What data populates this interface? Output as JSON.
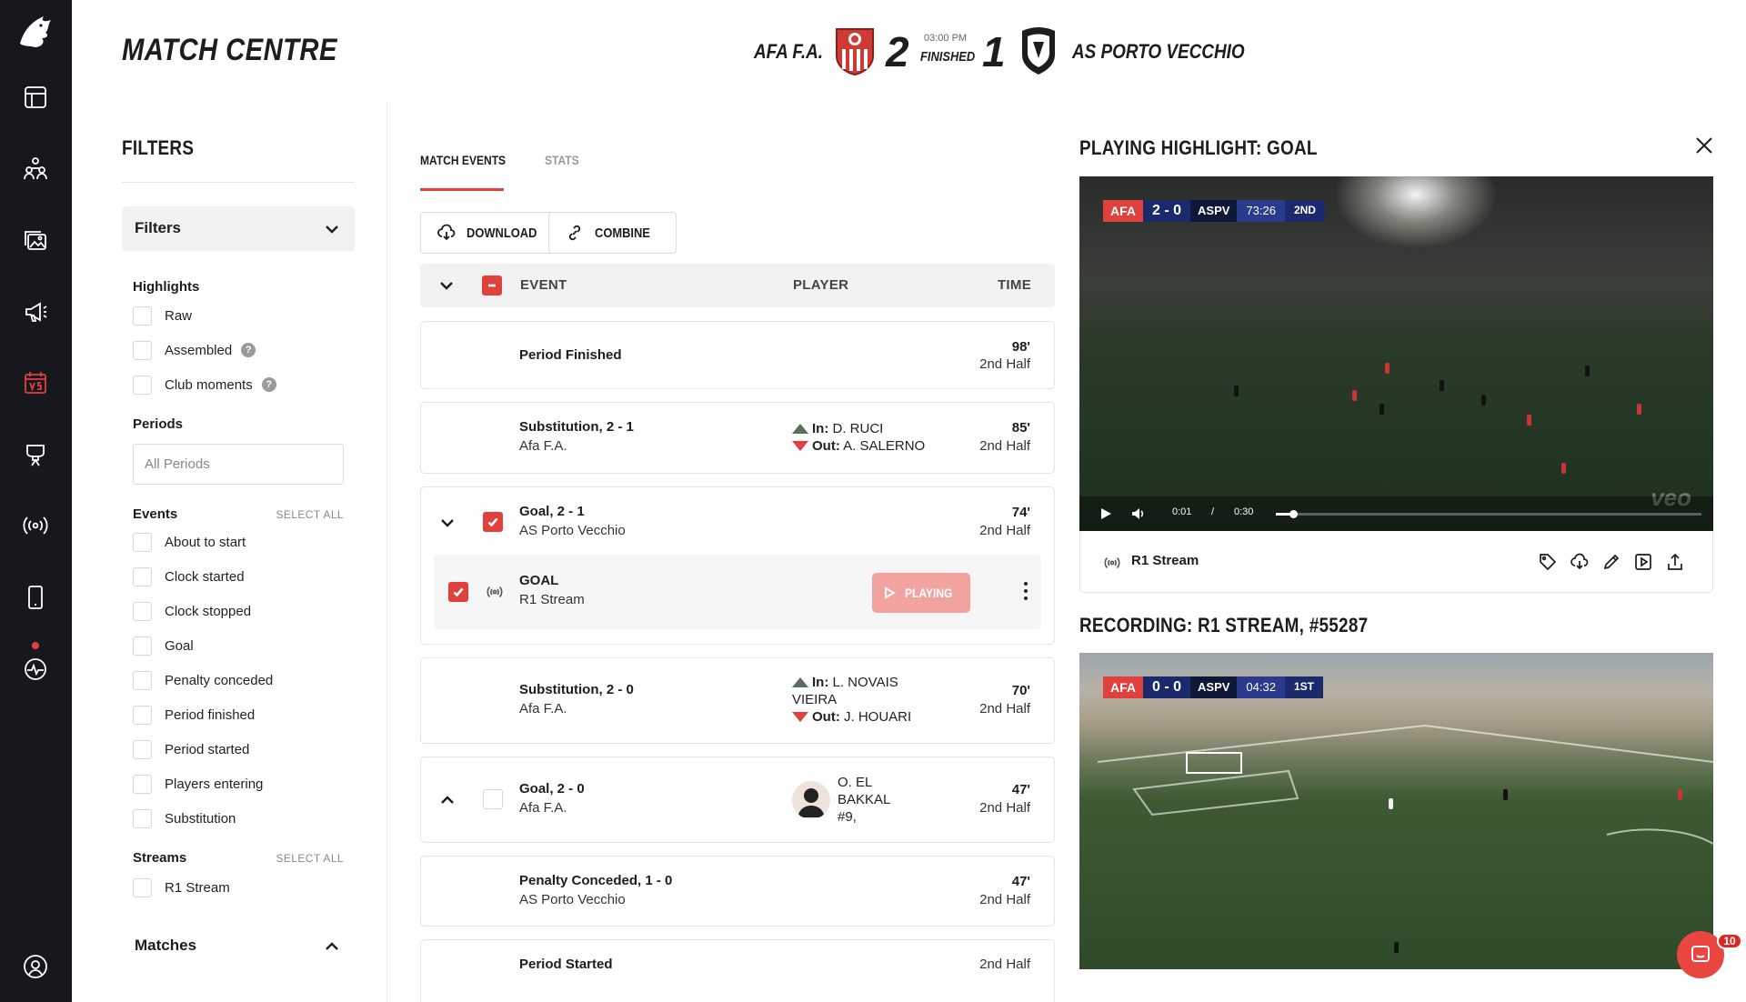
{
  "header": {
    "title": "MATCH CENTRE",
    "home_team": "AFA F.A.",
    "away_team": "AS PORTO VECCHIO",
    "home_score": "2",
    "away_score": "1",
    "kickoff_time": "03:00 PM",
    "status": "FINISHED"
  },
  "filters": {
    "title": "FILTERS",
    "dropdown_label": "Filters",
    "highlights_heading": "Highlights",
    "highlights": [
      "Raw",
      "Assembled",
      "Club moments"
    ],
    "periods_heading": "Periods",
    "periods_placeholder": "All Periods",
    "events_heading": "Events",
    "events_select_all": "SELECT ALL",
    "events": [
      "About to start",
      "Clock started",
      "Clock stopped",
      "Goal",
      "Penalty conceded",
      "Period finished",
      "Period started",
      "Players entering",
      "Substitution"
    ],
    "streams_heading": "Streams",
    "streams_select_all": "SELECT ALL",
    "streams": [
      "R1 Stream"
    ],
    "matches_label": "Matches"
  },
  "events_panel": {
    "tabs": [
      "MATCH EVENTS",
      "STATS"
    ],
    "download_label": "DOWNLOAD",
    "combine_label": "COMBINE",
    "col_event": "EVENT",
    "col_player": "PLAYER",
    "col_time": "TIME",
    "rows": [
      {
        "title": "Period Finished",
        "subtitle": "",
        "minute": "98'",
        "period": "2nd Half"
      },
      {
        "title": "Substitution, 2 - 1",
        "subtitle": "Afa F.A.",
        "in_label": "In:",
        "in_player": "D. RUCI",
        "out_label": "Out:",
        "out_player": "A. SALERNO",
        "minute": "85'",
        "period": "2nd Half"
      },
      {
        "title": "Goal, 2 - 1",
        "subtitle": "AS Porto Vecchio",
        "minute": "74'",
        "period": "2nd Half",
        "clip": {
          "title": "GOAL",
          "stream": "R1 Stream",
          "button": "PLAYING"
        }
      },
      {
        "title": "Substitution, 2 - 0",
        "subtitle": "Afa F.A.",
        "in_label": "In:",
        "in_player": "L. NOVAIS",
        "in_player_2": "VIEIRA",
        "out_label": "Out:",
        "out_player": "J. HOUARI",
        "minute": "70'",
        "period": "2nd Half"
      },
      {
        "title": "Goal, 2 - 0",
        "subtitle": "Afa F.A.",
        "scorer_1": "O. EL",
        "scorer_2": "BAKKAL",
        "scorer_3": "#9,",
        "minute": "47'",
        "period": "2nd Half"
      },
      {
        "title": "Penalty Conceded, 1 - 0",
        "subtitle": "AS Porto Vecchio",
        "minute": "47'",
        "period": "2nd Half"
      },
      {
        "title": "Period Started",
        "subtitle": "",
        "minute": "",
        "period": "2nd Half"
      }
    ]
  },
  "player": {
    "highlight_title": "PLAYING HIGHLIGHT: GOAL",
    "recording_title": "RECORDING: R1 STREAM, #55287",
    "stream_name": "R1 Stream",
    "video1": {
      "home": "AFA",
      "score": "2 - 0",
      "away": "ASPV",
      "clock": "73:26",
      "half": "2ND",
      "current": "0:01",
      "sep": "/",
      "duration": "0:30",
      "progress": 0.04,
      "watermark": "veo"
    },
    "video2": {
      "home": "AFA",
      "score": "0 - 0",
      "away": "ASPV",
      "clock": "04:32",
      "half": "1ST"
    }
  },
  "chat": {
    "badge": "10"
  },
  "colors": {
    "accent": "#e0413d",
    "rail": "#16181e"
  }
}
